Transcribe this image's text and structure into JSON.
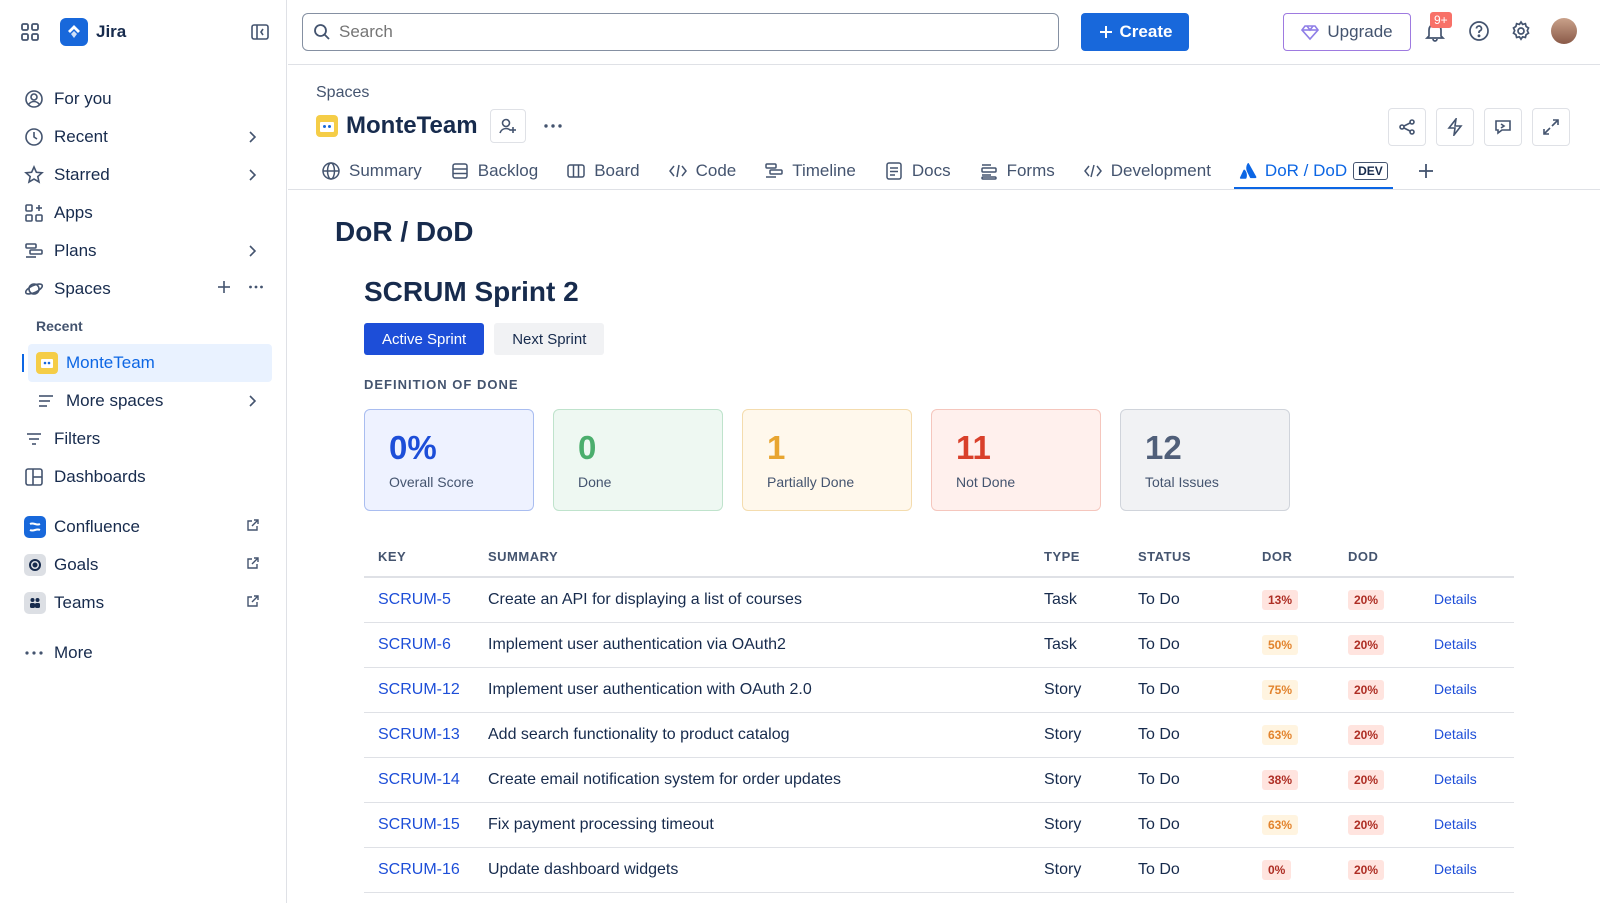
{
  "app": {
    "name": "Jira"
  },
  "sidebar": {
    "items": [
      {
        "label": "For you"
      },
      {
        "label": "Recent"
      },
      {
        "label": "Starred"
      },
      {
        "label": "Apps"
      },
      {
        "label": "Plans"
      },
      {
        "label": "Spaces"
      }
    ],
    "recent_label": "Recent",
    "active_space": "MonteTeam",
    "more_spaces": "More spaces",
    "filters": "Filters",
    "dashboards": "Dashboards",
    "apps": [
      {
        "label": "Confluence"
      },
      {
        "label": "Goals"
      },
      {
        "label": "Teams"
      }
    ],
    "more": "More"
  },
  "topbar": {
    "search_placeholder": "Search",
    "create_label": "Create",
    "upgrade_label": "Upgrade",
    "notification_count": "9+"
  },
  "header": {
    "breadcrumb": "Spaces",
    "project_name": "MonteTeam",
    "tabs": [
      {
        "label": "Summary"
      },
      {
        "label": "Backlog"
      },
      {
        "label": "Board"
      },
      {
        "label": "Code"
      },
      {
        "label": "Timeline"
      },
      {
        "label": "Docs"
      },
      {
        "label": "Forms"
      },
      {
        "label": "Development"
      },
      {
        "label": "DoR / DoD",
        "lozenge": "DEV"
      }
    ]
  },
  "content": {
    "page_title": "DoR / DoD",
    "sprint_title": "SCRUM Sprint 2",
    "sprint_tabs": [
      "Active Sprint",
      "Next Sprint"
    ],
    "section_label": "DEFINITION OF DONE",
    "cards": [
      {
        "value": "0%",
        "label": "Overall Score",
        "color": "#1d4ed8",
        "bg": "#eef2ff",
        "border": "#a9bdf0"
      },
      {
        "value": "0",
        "label": "Done",
        "color": "#4bae6d",
        "bg": "#eef8f2",
        "border": "#bfe3cc"
      },
      {
        "value": "1",
        "label": "Partially Done",
        "color": "#e8a530",
        "bg": "#fff8ec",
        "border": "#f4dcae"
      },
      {
        "value": "11",
        "label": "Not Done",
        "color": "#d9402b",
        "bg": "#fff0ed",
        "border": "#f5c6bd"
      },
      {
        "value": "12",
        "label": "Total Issues",
        "color": "#505f79",
        "bg": "#f1f2f4",
        "border": "#d0d4db"
      }
    ],
    "table": {
      "headers": [
        "KEY",
        "SUMMARY",
        "TYPE",
        "STATUS",
        "DOR",
        "DOD"
      ],
      "details_label": "Details",
      "rows": [
        {
          "key": "SCRUM-5",
          "summary": "Create an API for displaying a list of courses",
          "type": "Task",
          "status": "To Do",
          "dor": "13%",
          "dod": "20%",
          "dor_level": "low"
        },
        {
          "key": "SCRUM-6",
          "summary": "Implement user authentication via OAuth2",
          "type": "Task",
          "status": "To Do",
          "dor": "50%",
          "dod": "20%",
          "dor_level": "mid"
        },
        {
          "key": "SCRUM-12",
          "summary": "Implement user authentication with OAuth 2.0",
          "type": "Story",
          "status": "To Do",
          "dor": "75%",
          "dod": "20%",
          "dor_level": "mid"
        },
        {
          "key": "SCRUM-13",
          "summary": "Add search functionality to product catalog",
          "type": "Story",
          "status": "To Do",
          "dor": "63%",
          "dod": "20%",
          "dor_level": "mid"
        },
        {
          "key": "SCRUM-14",
          "summary": "Create email notification system for order updates",
          "type": "Story",
          "status": "To Do",
          "dor": "38%",
          "dod": "20%",
          "dor_level": "low"
        },
        {
          "key": "SCRUM-15",
          "summary": "Fix payment processing timeout",
          "type": "Story",
          "status": "To Do",
          "dor": "63%",
          "dod": "20%",
          "dor_level": "mid"
        },
        {
          "key": "SCRUM-16",
          "summary": "Update dashboard widgets",
          "type": "Story",
          "status": "To Do",
          "dor": "0%",
          "dod": "20%",
          "dor_level": "low"
        }
      ]
    }
  },
  "colors": {
    "accent": "#1868db",
    "pill_low_bg": "#ffe4df",
    "pill_low_fg": "#ae2e24",
    "pill_mid_bg": "#fff4e0",
    "pill_mid_fg": "#e2832d"
  }
}
